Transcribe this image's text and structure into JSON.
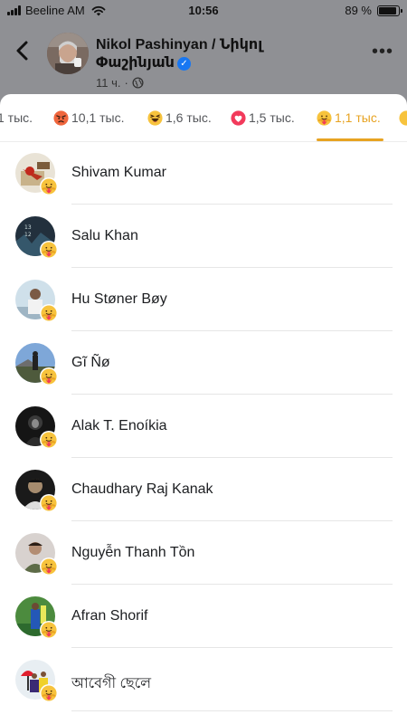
{
  "status_bar": {
    "carrier": "Beeline AM",
    "time": "10:56",
    "battery_text": "89 %",
    "battery_level": 0.89,
    "signal_icon": "signal-bars-icon",
    "wifi_icon": "wifi-icon"
  },
  "post": {
    "author_line1": "Nikol Pashinyan / Նիկոլ",
    "author_line2": "Փաշինյան",
    "verified_icon": "verified-badge-icon",
    "time_ago": "11 ч.",
    "separator": "·",
    "audience_icon": "globe-icon",
    "back_icon": "chevron-left-icon",
    "more_icon": "ellipsis-icon"
  },
  "tabs": [
    {
      "label": "1 тыс.",
      "icon": "",
      "selected": false
    },
    {
      "label": "10,1 тыс.",
      "icon": "angry-reaction-icon",
      "selected": false
    },
    {
      "label": "1,6 тыс.",
      "icon": "haha-reaction-icon",
      "selected": false
    },
    {
      "label": "1,5 тыс.",
      "icon": "love-reaction-icon",
      "selected": false
    },
    {
      "label": "1,1 тыс.",
      "icon": "care-reaction-icon",
      "selected": true
    },
    {
      "label": "",
      "icon": "reaction-icon",
      "selected": false
    }
  ],
  "colors": {
    "accent": "#e7a322",
    "sheet_background": "#ffffff",
    "header_background": "#8f9094",
    "text_primary": "#1c1e21",
    "verified_blue": "#1877f2"
  },
  "people": [
    {
      "name": "Shivam Kumar",
      "reaction_icon": "care-reaction-icon"
    },
    {
      "name": "Salu Khan",
      "reaction_icon": "care-reaction-icon"
    },
    {
      "name": "Hu Støner Bøy",
      "reaction_icon": "care-reaction-icon"
    },
    {
      "name": "Gĩ Ñø",
      "reaction_icon": "care-reaction-icon"
    },
    {
      "name": "Alak T. Enoíkia",
      "reaction_icon": "care-reaction-icon"
    },
    {
      "name": "Chaudhary Raj Kanak",
      "reaction_icon": "care-reaction-icon"
    },
    {
      "name": "Nguyễn Thanh Tồn",
      "reaction_icon": "care-reaction-icon"
    },
    {
      "name": "Afran Shorif",
      "reaction_icon": "care-reaction-icon"
    },
    {
      "name": "আবেগী ছেলে",
      "reaction_icon": "care-reaction-icon"
    }
  ]
}
